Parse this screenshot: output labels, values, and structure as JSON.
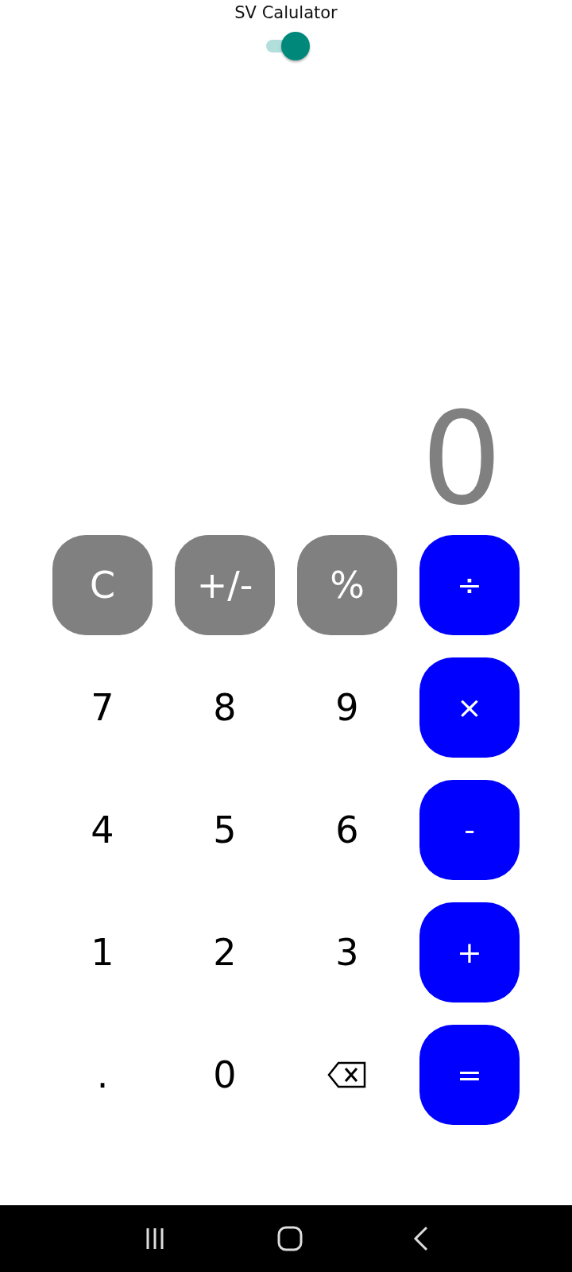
{
  "title": "SV Calulator",
  "theme_switch": {
    "on": true
  },
  "display": "0",
  "keys": [
    {
      "kind": "function",
      "label": "C"
    },
    {
      "kind": "function",
      "label": "+/-"
    },
    {
      "kind": "function",
      "label": "%"
    },
    {
      "kind": "operator",
      "label": "÷"
    },
    {
      "kind": "digit",
      "label": "7"
    },
    {
      "kind": "digit",
      "label": "8"
    },
    {
      "kind": "digit",
      "label": "9"
    },
    {
      "kind": "operator",
      "label": "×"
    },
    {
      "kind": "digit",
      "label": "4"
    },
    {
      "kind": "digit",
      "label": "5"
    },
    {
      "kind": "digit",
      "label": "6"
    },
    {
      "kind": "operator",
      "label": "-"
    },
    {
      "kind": "digit",
      "label": "1"
    },
    {
      "kind": "digit",
      "label": "2"
    },
    {
      "kind": "digit",
      "label": "3"
    },
    {
      "kind": "operator",
      "label": "+"
    },
    {
      "kind": "digit",
      "label": "."
    },
    {
      "kind": "digit",
      "label": "0"
    },
    {
      "kind": "backspace"
    },
    {
      "kind": "operator",
      "label": "="
    }
  ]
}
